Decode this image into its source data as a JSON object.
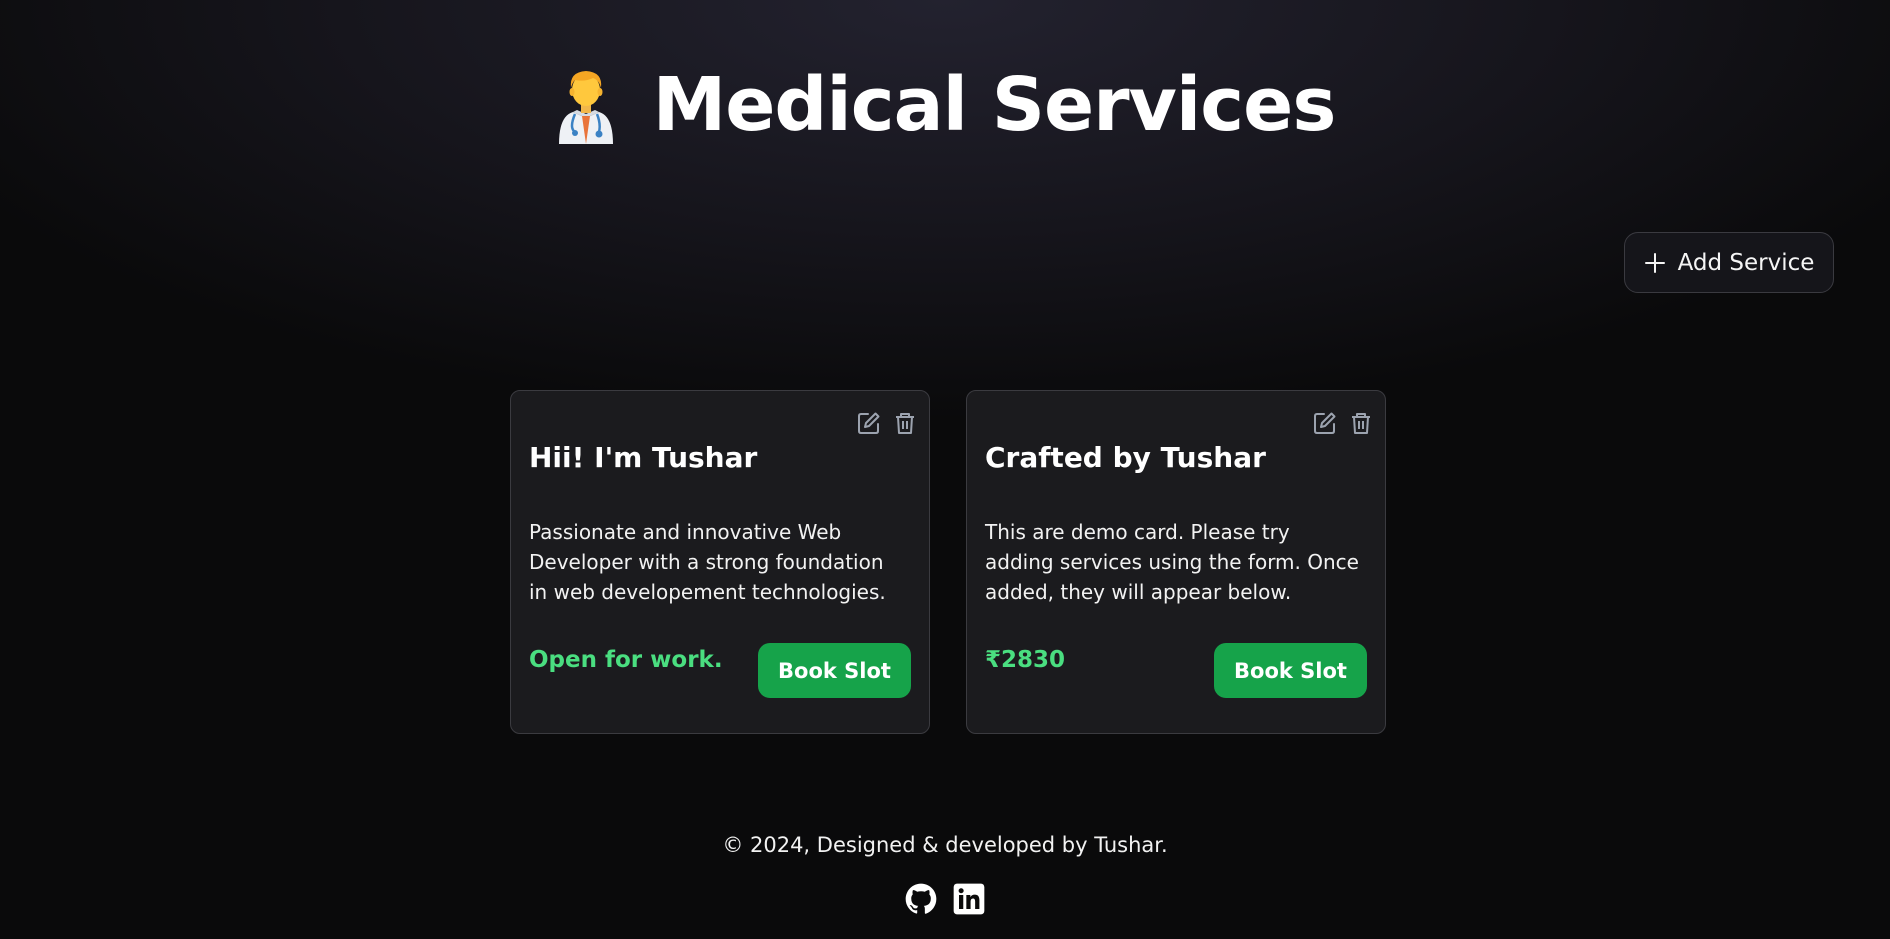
{
  "header": {
    "title": "Medical Services",
    "icon": "doctor-emoji-icon"
  },
  "toolbar": {
    "add_service_label": "Add Service",
    "add_icon": "plus-icon"
  },
  "cards": [
    {
      "title": "Hii! I'm Tushar",
      "description": "Passionate and innovative Web Developer with a strong foundation in web developement technologies.",
      "price": "Open for work.",
      "book_label": "Book Slot",
      "actions": [
        "edit-icon",
        "trash-icon"
      ]
    },
    {
      "title": "Crafted by Tushar",
      "description": "This are demo card. Please try adding services using the form. Once added, they will appear below.",
      "price": "₹2830",
      "book_label": "Book Slot",
      "actions": [
        "edit-icon",
        "trash-icon"
      ]
    }
  ],
  "footer": {
    "text": "© 2024, Designed & developed by Tushar.",
    "social_icons": [
      "github-icon",
      "linkedin-icon"
    ]
  },
  "colors": {
    "accent_green": "#16a34a",
    "price_green": "#4ade80",
    "card_bg": "#1b1b1e",
    "page_bg": "#0a0a0b"
  }
}
